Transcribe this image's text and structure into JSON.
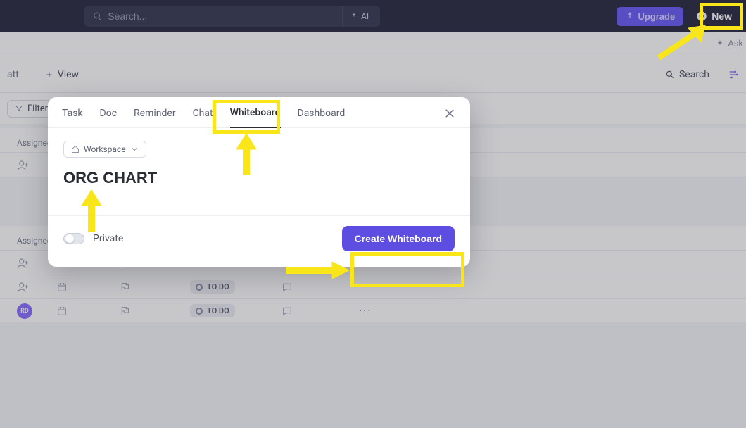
{
  "topbar": {
    "search_placeholder": "Search...",
    "ai_label": "AI",
    "upgrade_label": "Upgrade",
    "new_label": "New"
  },
  "secondary": {
    "ask_label": "Ask"
  },
  "list_toolbar": {
    "crumb_fragment": "att",
    "view_label": "View",
    "search_label": "Search"
  },
  "filter_bar": {
    "filters_label": "Filters"
  },
  "table": {
    "section1_header": "Assignee",
    "section2_header": "Assignee",
    "rows": [
      {
        "avatar_type": "add",
        "avatar_text": "",
        "status": ""
      },
      {
        "avatar_type": "add",
        "avatar_text": "",
        "status": "TO DO"
      },
      {
        "avatar_type": "add",
        "avatar_text": "",
        "status": "TO DO"
      },
      {
        "avatar_type": "dot",
        "avatar_text": "RD",
        "status": "TO DO"
      }
    ]
  },
  "modal": {
    "tabs": [
      {
        "label": "Task",
        "active": false
      },
      {
        "label": "Doc",
        "active": false
      },
      {
        "label": "Reminder",
        "active": false
      },
      {
        "label": "Chat",
        "active": false
      },
      {
        "label": "Whiteboard",
        "active": true
      },
      {
        "label": "Dashboard",
        "active": false
      }
    ],
    "workspace_chip": "Workspace",
    "title_value": "ORG CHART",
    "private_label": "Private",
    "create_label": "Create Whiteboard"
  }
}
